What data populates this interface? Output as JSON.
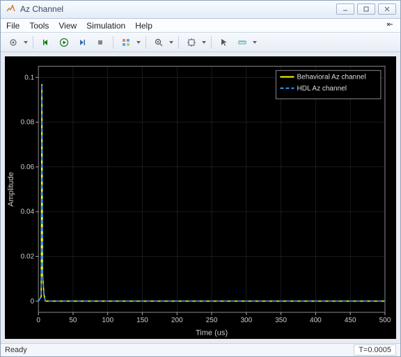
{
  "window": {
    "title": "Az Channel"
  },
  "menu": {
    "file": "File",
    "tools": "Tools",
    "view": "View",
    "simulation": "Simulation",
    "help": "Help"
  },
  "status": {
    "ready": "Ready",
    "time": "T=0.0005"
  },
  "chart_data": {
    "type": "line",
    "title": "",
    "xlabel": "Time (us)",
    "ylabel": "Amplitude",
    "xlim": [
      0,
      500
    ],
    "ylim": [
      -0.005,
      0.105
    ],
    "xticks": [
      0,
      50,
      100,
      150,
      200,
      250,
      300,
      350,
      400,
      450,
      500
    ],
    "yticks": [
      0,
      0.02,
      0.04,
      0.06,
      0.08,
      0.1
    ],
    "legend_position": "northeast",
    "series": [
      {
        "name": "Behavioral Az channel",
        "color": "#ffff00",
        "style": "solid",
        "x": [
          0,
          4,
          5,
          6,
          8,
          10,
          20,
          50,
          100,
          200,
          300,
          400,
          500
        ],
        "y": [
          0,
          0.002,
          0.097,
          0.012,
          0.003,
          0.0,
          0.0,
          0.0,
          0.0,
          0.0,
          0.0,
          0.0,
          0.0
        ]
      },
      {
        "name": "HDL Az channel",
        "color": "#3399ff",
        "style": "dashed",
        "x": [
          0,
          4,
          5,
          6,
          8,
          10,
          20,
          50,
          100,
          200,
          300,
          400,
          500
        ],
        "y": [
          0,
          0.002,
          0.097,
          0.012,
          0.003,
          0.0,
          0.0,
          0.0,
          0.0,
          0.0,
          0.0,
          0.0,
          0.0
        ]
      }
    ]
  }
}
